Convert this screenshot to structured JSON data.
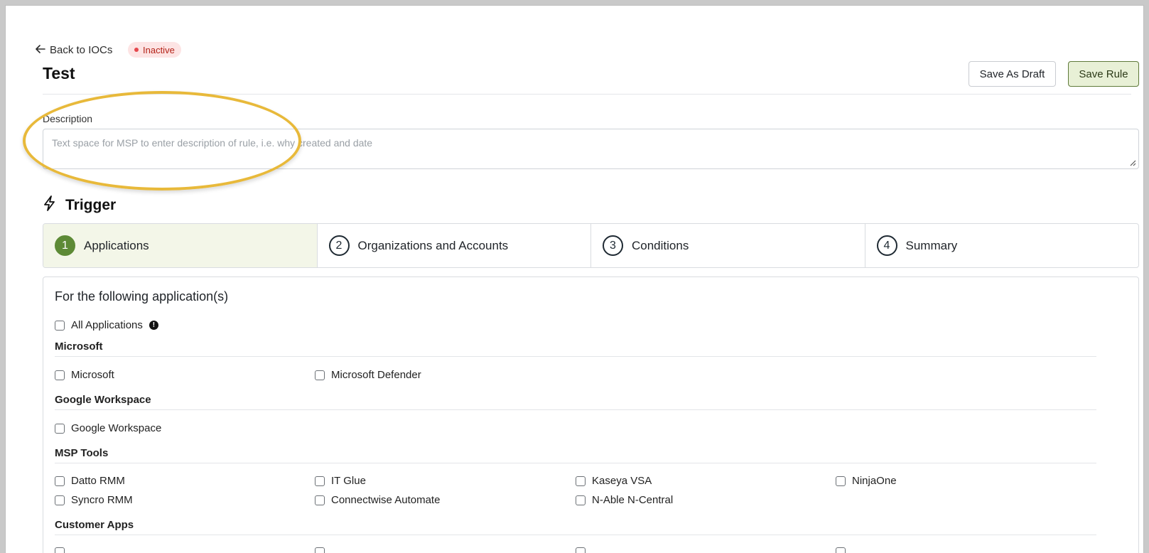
{
  "header": {
    "back_label": "Back to IOCs",
    "status_badge": "Inactive",
    "title": "Test",
    "save_draft_label": "Save As Draft",
    "save_rule_label": "Save Rule"
  },
  "description": {
    "label": "Description",
    "placeholder": "Text space for MSP to enter description of rule, i.e. why created and date"
  },
  "trigger": {
    "title": "Trigger",
    "steps": [
      {
        "num": "1",
        "label": "Applications"
      },
      {
        "num": "2",
        "label": "Organizations and Accounts"
      },
      {
        "num": "3",
        "label": "Conditions"
      },
      {
        "num": "4",
        "label": "Summary"
      }
    ]
  },
  "applications": {
    "heading": "For the following application(s)",
    "all_label": "All Applications",
    "sections": [
      {
        "title": "Microsoft",
        "items": [
          "Microsoft",
          "Microsoft Defender"
        ]
      },
      {
        "title": "Google Workspace",
        "items": [
          "Google Workspace"
        ]
      },
      {
        "title": "MSP Tools",
        "items": [
          "Datto RMM",
          "IT Glue",
          "Kaseya VSA",
          "NinjaOne",
          "Syncro RMM",
          "Connectwise Automate",
          "N-Able N-Central"
        ]
      },
      {
        "title": "Customer Apps",
        "items": [
          "",
          "",
          "",
          ""
        ]
      }
    ]
  },
  "colors": {
    "accent_green": "#5d8a36",
    "badge_bg": "#fde4e4",
    "highlight_ellipse": "#e8b93a"
  }
}
